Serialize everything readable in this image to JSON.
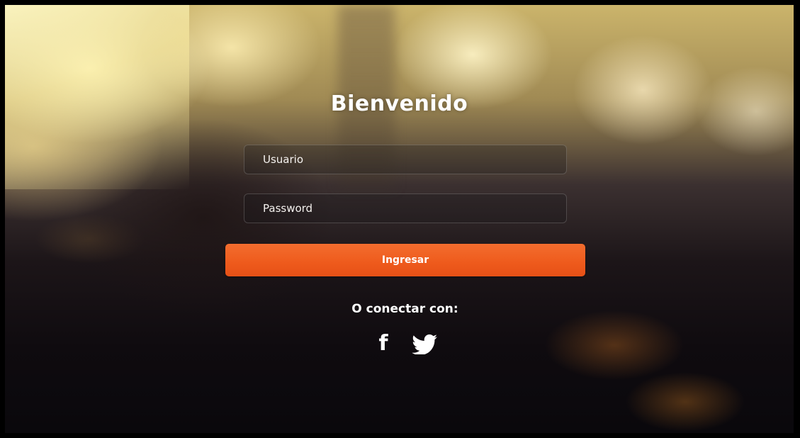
{
  "login": {
    "title": "Bienvenido",
    "username_placeholder": "Usuario",
    "username_value": "",
    "password_placeholder": "Password",
    "password_value": "",
    "submit_label": "Ingresar",
    "connect_text": "O conectar con:"
  },
  "social": {
    "facebook_glyph": "f",
    "icons": [
      "facebook-icon",
      "twitter-icon"
    ]
  },
  "colors": {
    "accent": "#ee5a1c",
    "text": "#ffffff"
  }
}
